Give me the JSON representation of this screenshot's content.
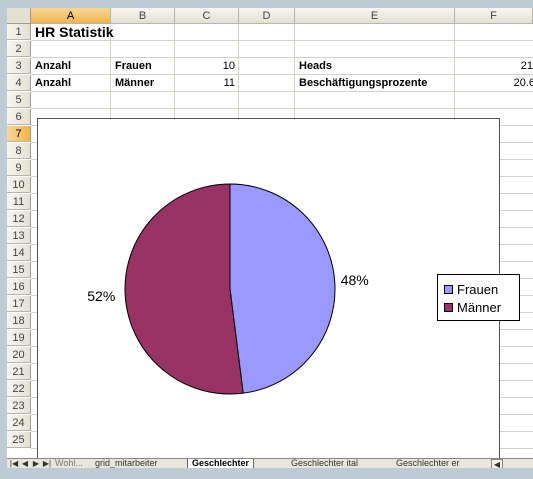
{
  "columns": [
    "A",
    "B",
    "C",
    "D",
    "E",
    "F"
  ],
  "selected_column": "A",
  "rows": [
    "1",
    "2",
    "3",
    "4",
    "5",
    "6",
    "7",
    "8",
    "9",
    "10",
    "11",
    "12",
    "13",
    "14",
    "15",
    "16",
    "17",
    "18",
    "19",
    "20",
    "21",
    "22",
    "23",
    "24",
    "25"
  ],
  "selected_row": "7",
  "cells": {
    "a1": "HR Statistik",
    "a3": "Anzahl",
    "b3": "Frauen",
    "c3": "10",
    "e3": "Heads",
    "f3": "21",
    "a4": "Anzahl",
    "b4": "Männer",
    "c4": "11",
    "e4": "Beschäftigungsprozente",
    "f4": "20.6"
  },
  "chart_data": {
    "type": "pie",
    "categories": [
      "Frauen",
      "Männer"
    ],
    "values": [
      48,
      52
    ],
    "labels": [
      "48%",
      "52%"
    ],
    "colors": [
      "#9999ff",
      "#993366"
    ],
    "legend": "right"
  },
  "sheet_tabs": {
    "partial_left": "Wohl...",
    "items": [
      "grid_mitarbeiter",
      "Geschlechter",
      "Geschlechter ital",
      "Geschlechter er"
    ],
    "active": "Geschlechter"
  },
  "icons": [
    "first-sheet-icon",
    "prev-sheet-icon",
    "next-sheet-icon",
    "last-sheet-icon"
  ]
}
